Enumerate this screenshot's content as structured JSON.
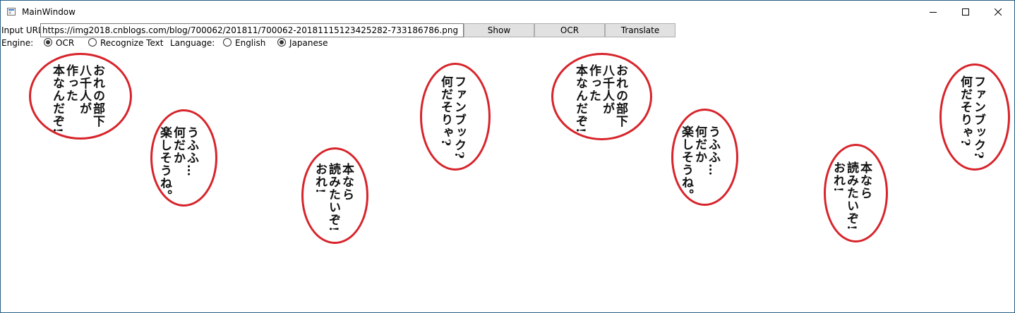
{
  "window": {
    "title": "MainWindow",
    "icon": "window-app-icon"
  },
  "controls": {
    "url_label": "Input URL:",
    "url_value": "https://img2018.cnblogs.com/blog/700062/201811/700062-20181115123425282-733186786.png",
    "show_label": "Show",
    "ocr_label": "OCR",
    "translate_label": "Translate"
  },
  "engine": {
    "label": "Engine:",
    "options": [
      {
        "label": "OCR",
        "checked": true
      },
      {
        "label": "Recognize Text",
        "checked": false
      }
    ]
  },
  "language": {
    "label": "Language:",
    "options": [
      {
        "label": "English",
        "checked": false
      },
      {
        "label": "Japanese",
        "checked": true
      }
    ]
  },
  "bubbles": [
    {
      "text": "おれの部下\n八千人が\n作った\n本なんだぞ!"
    },
    {
      "text": "うふふ…\n何だか\n楽しそうね。"
    },
    {
      "text": "本なら\n読みたいぞ!\nおれ!"
    },
    {
      "text": "ファンブック?\n何だそりゃ?"
    },
    {
      "text": "おれの部下\n八千人が\n作った\n本なんだぞ!"
    },
    {
      "text": "うふふ…\n何だか\n楽しそうね。"
    },
    {
      "text": "本なら\n読みたいぞ!\nおれ!"
    },
    {
      "text": "ファンブック?\n何だそりゃ?"
    }
  ],
  "colors": {
    "bubble_border": "#d7242b",
    "window_border": "#2b5f86"
  }
}
